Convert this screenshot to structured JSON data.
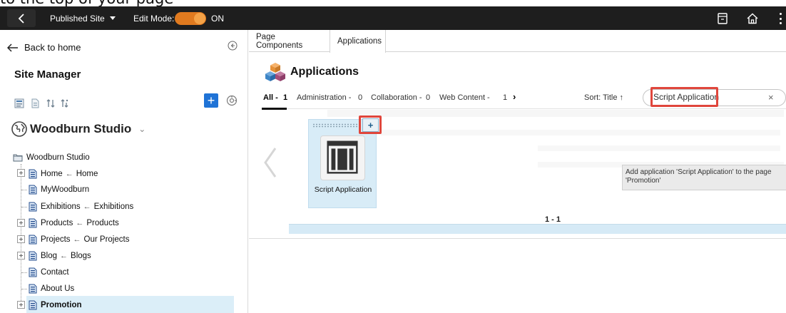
{
  "caption_fragment": "to the top of your page",
  "topbar": {
    "back_label": "<",
    "published_label": "Published Site",
    "edit_mode_label": "Edit Mode:",
    "edit_mode_state": "ON",
    "toggle_color": "#e07a1f"
  },
  "left_panel": {
    "back_home": "Back to home",
    "site_manager": "Site Manager",
    "site_title": "Woodburn Studio",
    "tree": {
      "root": "Woodburn Studio",
      "items": [
        {
          "label": "Home",
          "alias": "Home",
          "expandable": true
        },
        {
          "label": "MyWoodburn",
          "alias": "",
          "expandable": false
        },
        {
          "label": "Exhibitions",
          "alias": "Exhibitions",
          "expandable": false
        },
        {
          "label": "Products",
          "alias": "Products",
          "expandable": true
        },
        {
          "label": "Projects",
          "alias": "Our Projects",
          "expandable": true
        },
        {
          "label": "Blog",
          "alias": "Blogs",
          "expandable": true
        },
        {
          "label": "Contact",
          "alias": "",
          "expandable": false
        },
        {
          "label": "About Us",
          "alias": "",
          "expandable": false
        },
        {
          "label": "Promotion",
          "alias": "",
          "expandable": true,
          "selected": true
        }
      ]
    },
    "arrow": "←"
  },
  "right_panel": {
    "tabs": [
      "Page Components",
      "Applications"
    ],
    "active_tab": "Applications",
    "header_title": "Applications",
    "filters": {
      "all_label": "All -",
      "all_count": "1",
      "administration_label": "Administration -",
      "administration_count": "0",
      "collaboration_label": "Collaboration -",
      "collaboration_count": "0",
      "web_content_label": "Web Content -",
      "web_content_count": "1",
      "more": "›"
    },
    "sort_label": "Sort: Title",
    "sort_arrow": "↑",
    "search_value": "Script Application",
    "search_clear": "×",
    "app_tile_label": "Script Application",
    "add_button": "+",
    "tooltip": "Add application 'Script Application' to the page 'Promotion'",
    "pager": "1 - 1"
  }
}
